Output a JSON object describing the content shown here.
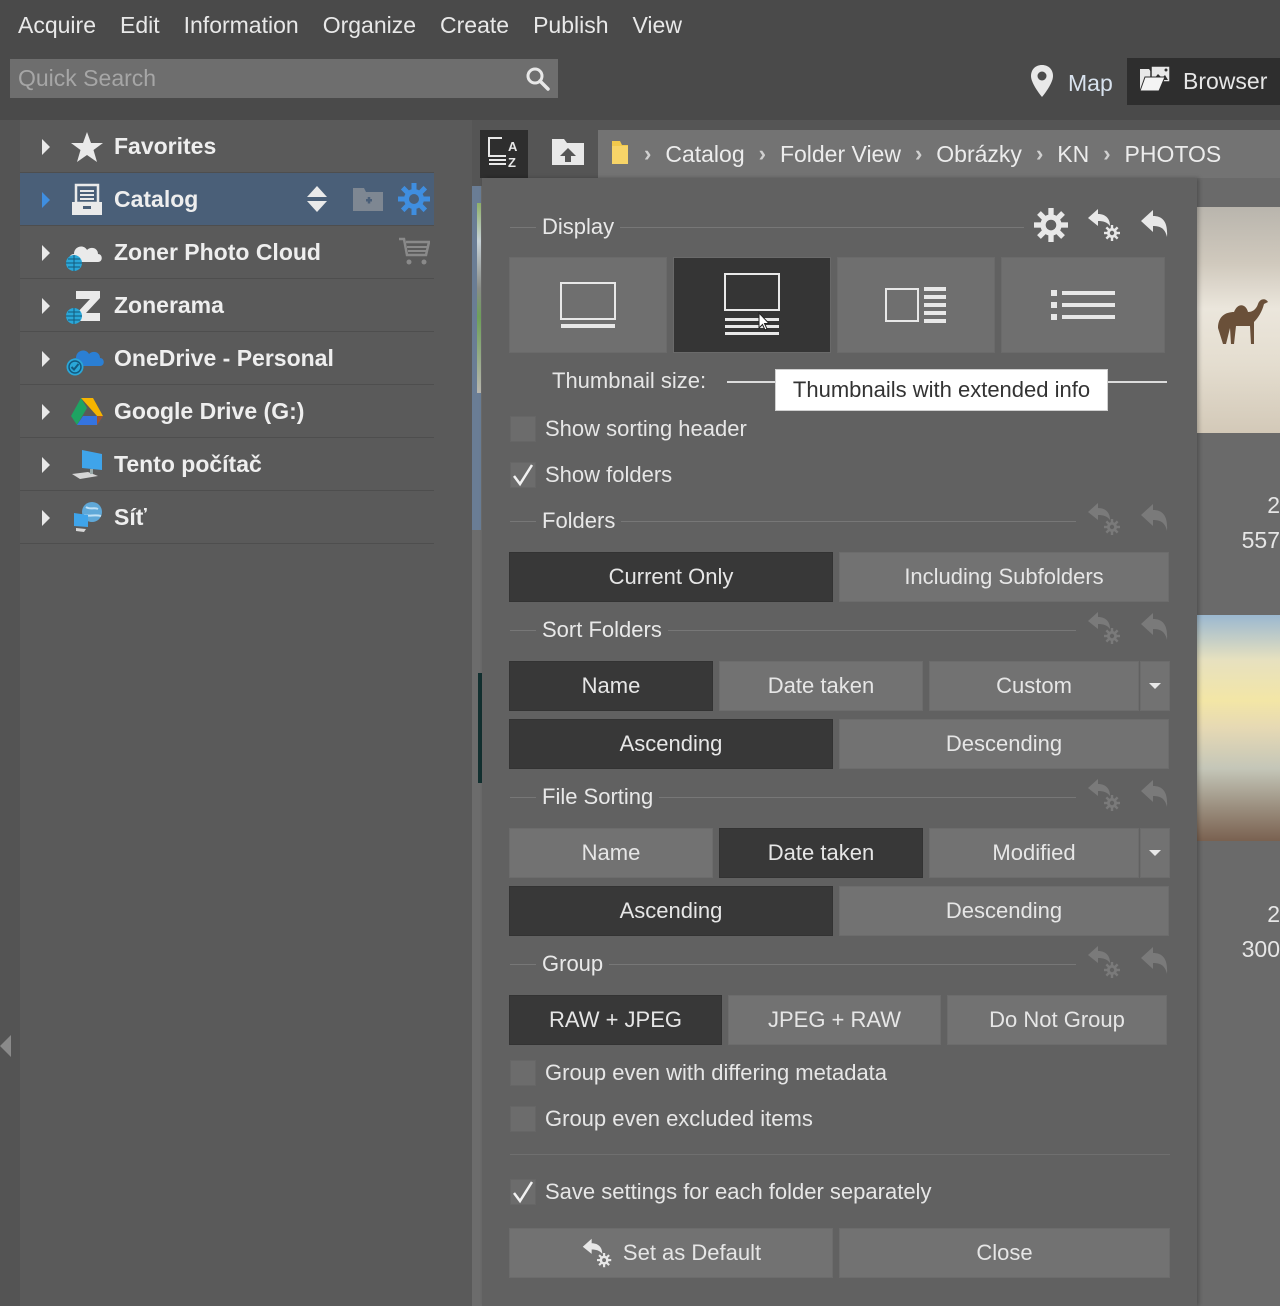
{
  "menu": {
    "items": [
      "Acquire",
      "Edit",
      "Information",
      "Organize",
      "Create",
      "Publish",
      "View"
    ]
  },
  "search": {
    "placeholder": "Quick Search",
    "value": ""
  },
  "modes": {
    "map_label": "Map",
    "browser_label": "Browser",
    "active": "Browser"
  },
  "navigator": {
    "items": [
      {
        "label": "Favorites",
        "icon": "star-icon",
        "selected": false
      },
      {
        "label": "Catalog",
        "icon": "catalog-icon",
        "selected": true
      },
      {
        "label": "Zoner Photo Cloud",
        "icon": "cloud-icon",
        "selected": false
      },
      {
        "label": "Zonerama",
        "icon": "zonerama-icon",
        "selected": false
      },
      {
        "label": "OneDrive - Personal",
        "icon": "onedrive-icon",
        "selected": false
      },
      {
        "label": "Google Drive (G:)",
        "icon": "google-drive-icon",
        "selected": false
      },
      {
        "label": "Tento počítač",
        "icon": "computer-icon",
        "selected": false
      },
      {
        "label": "Síť",
        "icon": "network-icon",
        "selected": false
      }
    ]
  },
  "breadcrumb": {
    "items": [
      "Catalog",
      "Folder View",
      "Obrázky",
      "KN",
      "PHOTOS"
    ]
  },
  "thumbnails": [
    {
      "line1": "2",
      "line2": "557"
    },
    {
      "line1": "2",
      "line2": "300"
    }
  ],
  "panel": {
    "display": {
      "title": "Display",
      "view_modes": [
        "Thumbnails",
        "Thumbnails with extended info",
        "Thumbnails with details",
        "List"
      ],
      "active_view": 1,
      "thumbnail_size_label": "Thumbnail size:",
      "tooltip": "Thumbnails with extended info"
    },
    "checkboxes_top": [
      {
        "label": "Show sorting header",
        "checked": false
      },
      {
        "label": "Show folders",
        "checked": true
      }
    ],
    "folders": {
      "title": "Folders",
      "options": [
        "Current Only",
        "Including Subfolders"
      ],
      "active": 0
    },
    "sort_folders": {
      "title": "Sort Folders",
      "by": [
        "Name",
        "Date taken",
        "Custom"
      ],
      "active_by": 0,
      "order": [
        "Ascending",
        "Descending"
      ],
      "active_order": 0
    },
    "file_sorting": {
      "title": "File Sorting",
      "by": [
        "Name",
        "Date taken",
        "Modified"
      ],
      "active_by": 1,
      "order": [
        "Ascending",
        "Descending"
      ],
      "active_order": 0
    },
    "group": {
      "title": "Group",
      "options": [
        "RAW + JPEG",
        "JPEG + RAW",
        "Do Not Group"
      ],
      "active": 0,
      "checkboxes": [
        {
          "label": "Group even with differing metadata",
          "checked": false
        },
        {
          "label": "Group even excluded items",
          "checked": false
        }
      ]
    },
    "save_separately": {
      "label": "Save settings for each folder separately",
      "checked": true
    },
    "set_default_label": "Set as Default",
    "close_label": "Close"
  },
  "colors": {
    "accent_blue": "#3f8ee0",
    "selected_row": "#4a5f78",
    "active_button": "#383838"
  }
}
